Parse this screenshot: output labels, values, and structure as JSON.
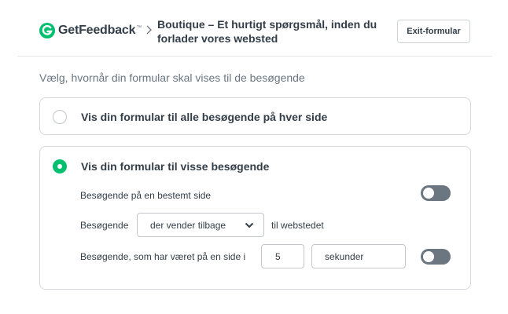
{
  "header": {
    "logo_text": "GetFeedback",
    "logo_tm": "™",
    "breadcrumb_title": "Boutique – Et hurtigt spørgsmål, inden du forlader vores websted",
    "exit_button": "Exit-formular",
    "brand_color": "#00bf6f"
  },
  "question": "Vælg, hvornår din formular skal vises til de besøgende",
  "options": [
    {
      "label": "Vis din formular til alle besøgende på hver side",
      "selected": false
    },
    {
      "label": "Vis din formular til visse besøgende",
      "selected": true,
      "rules": {
        "specific_page": {
          "label": "Besøgende på en bestemt side",
          "toggle_on": false
        },
        "returning": {
          "prefix": "Besøgende",
          "select_value": "der vender tilbage",
          "suffix": "til webstedet"
        },
        "time_on_page": {
          "label": "Besøgende, som har været på en side i",
          "value": "5",
          "unit": "sekunder",
          "toggle_on": false
        }
      }
    }
  ]
}
